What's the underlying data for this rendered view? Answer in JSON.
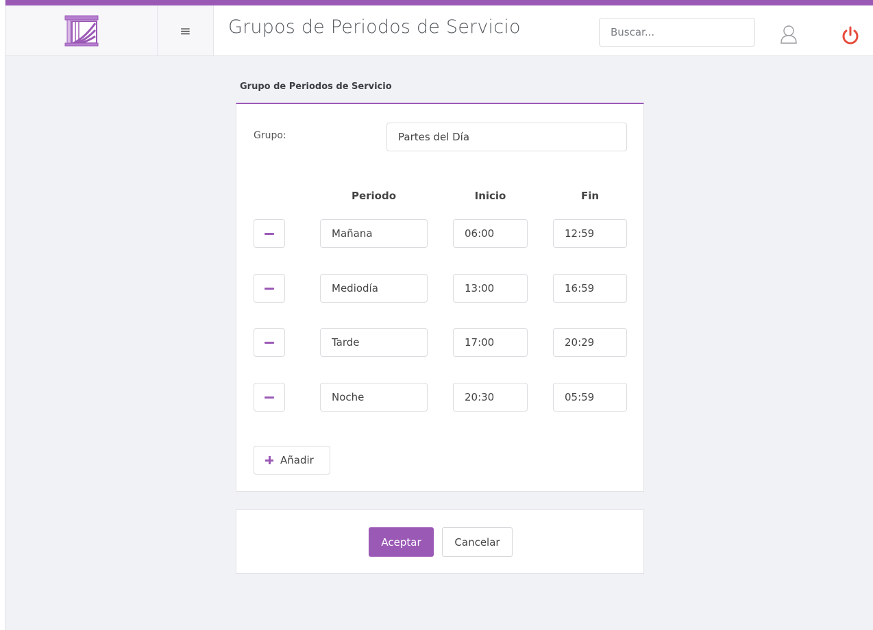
{
  "header": {
    "title": "Grupos de Periodos de Servicio",
    "search_placeholder": "Buscar...",
    "menu_glyph": "≡",
    "icons": [
      "logo-icon",
      "hamburger-menu-icon",
      "user-icon",
      "power-icon"
    ]
  },
  "form": {
    "section_title": "Grupo de Periodos de Servicio",
    "group_label": "Grupo:",
    "group_value": "Partes del Día",
    "columns": {
      "periodo": "Periodo",
      "inicio": "Inicio",
      "fin": "Fin"
    },
    "rows": [
      {
        "periodo": "Mañana",
        "inicio": "06:00",
        "fin": "12:59"
      },
      {
        "periodo": "Mediodía",
        "inicio": "13:00",
        "fin": "16:59"
      },
      {
        "periodo": "Tarde",
        "inicio": "17:00",
        "fin": "20:29"
      },
      {
        "periodo": "Noche",
        "inicio": "20:30",
        "fin": "05:59"
      }
    ],
    "add_label": "Añadir"
  },
  "actions": {
    "accept_label": "Aceptar",
    "cancel_label": "Cancelar"
  },
  "colors": {
    "accent": "#9b59b6",
    "power": "#e74c3c",
    "background": "#f1f2f6"
  }
}
